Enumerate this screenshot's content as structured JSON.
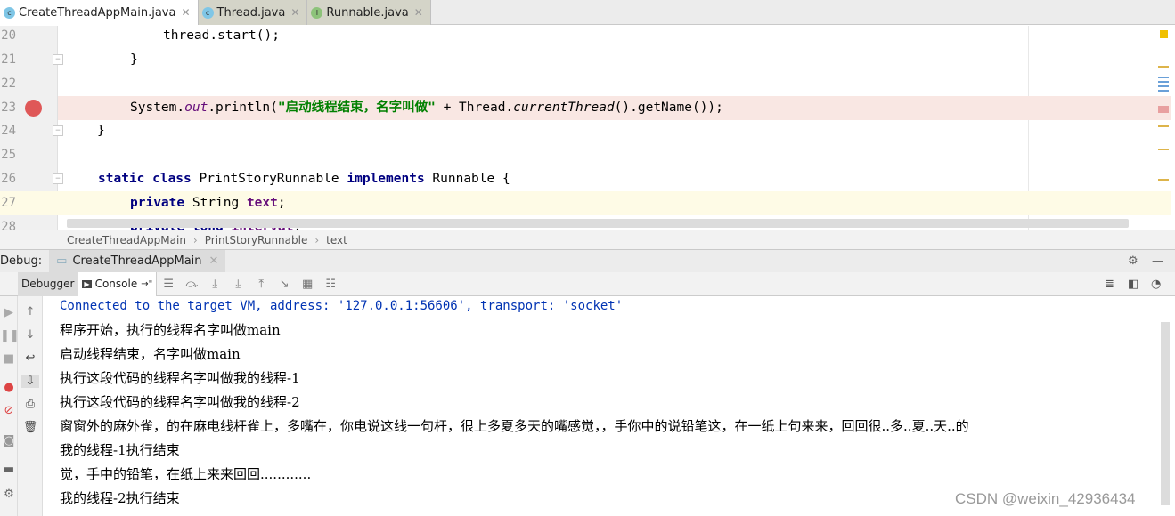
{
  "tabs": [
    {
      "label": "CreateThreadAppMain.java",
      "icon": "class-icon",
      "active": true
    },
    {
      "label": "Thread.java",
      "icon": "class-icon"
    },
    {
      "label": "Runnable.java",
      "icon": "interface-icon"
    }
  ],
  "editor": {
    "line_numbers": [
      "20",
      "21",
      "22",
      "23",
      "24",
      "25",
      "26",
      "27",
      "28"
    ],
    "l20": "thread.start();",
    "l21": "}",
    "l23": {
      "a": "System.",
      "b": "out",
      "c": ".println(",
      "d": "\"启动线程结束，名字叫做\"",
      "e": " + Thread.",
      "f": "currentThread",
      "g": "().getName());"
    },
    "l24": "}",
    "l26": {
      "a": "static class ",
      "b": "PrintStoryRunnable ",
      "c": "implements ",
      "d": "Runnable {"
    },
    "l27": {
      "a": "private ",
      "b": "String ",
      "c": "text",
      "d": ";"
    },
    "l28": {
      "a": "private long ",
      "b": "interval",
      "c": ";"
    }
  },
  "breadcrumb": [
    "CreateThreadAppMain",
    "PrintStoryRunnable",
    "text"
  ],
  "debug": {
    "label": "Debug:",
    "session": "CreateThreadAppMain",
    "tab_debugger": "Debugger",
    "tab_console": "Console",
    "console_suffix": "→\""
  },
  "console": [
    "Connected to the target VM, address: '127.0.0.1:56606', transport: 'socket'",
    "程序开始，执行的线程名字叫做main",
    "启动线程结束，名字叫做main",
    "执行这段代码的线程名字叫做我的线程-1",
    "执行这段代码的线程名字叫做我的线程-2",
    "窗窗外的麻外雀，的在麻电线杆雀上，多嘴在，你电说这线一句杆，很上多夏多天的嘴感觉，，手你中的说铅笔这，在一纸上句来来，回回很..多..夏..天..的",
    "我的线程-1执行结束",
    "觉，手中的铅笔，在纸上来来回回............",
    "我的线程-2执行结束"
  ],
  "watermark": "CSDN @weixin_42936434",
  "colors": {
    "breakpoint": "#df5858",
    "keyword": "#000080",
    "string": "#008000"
  }
}
